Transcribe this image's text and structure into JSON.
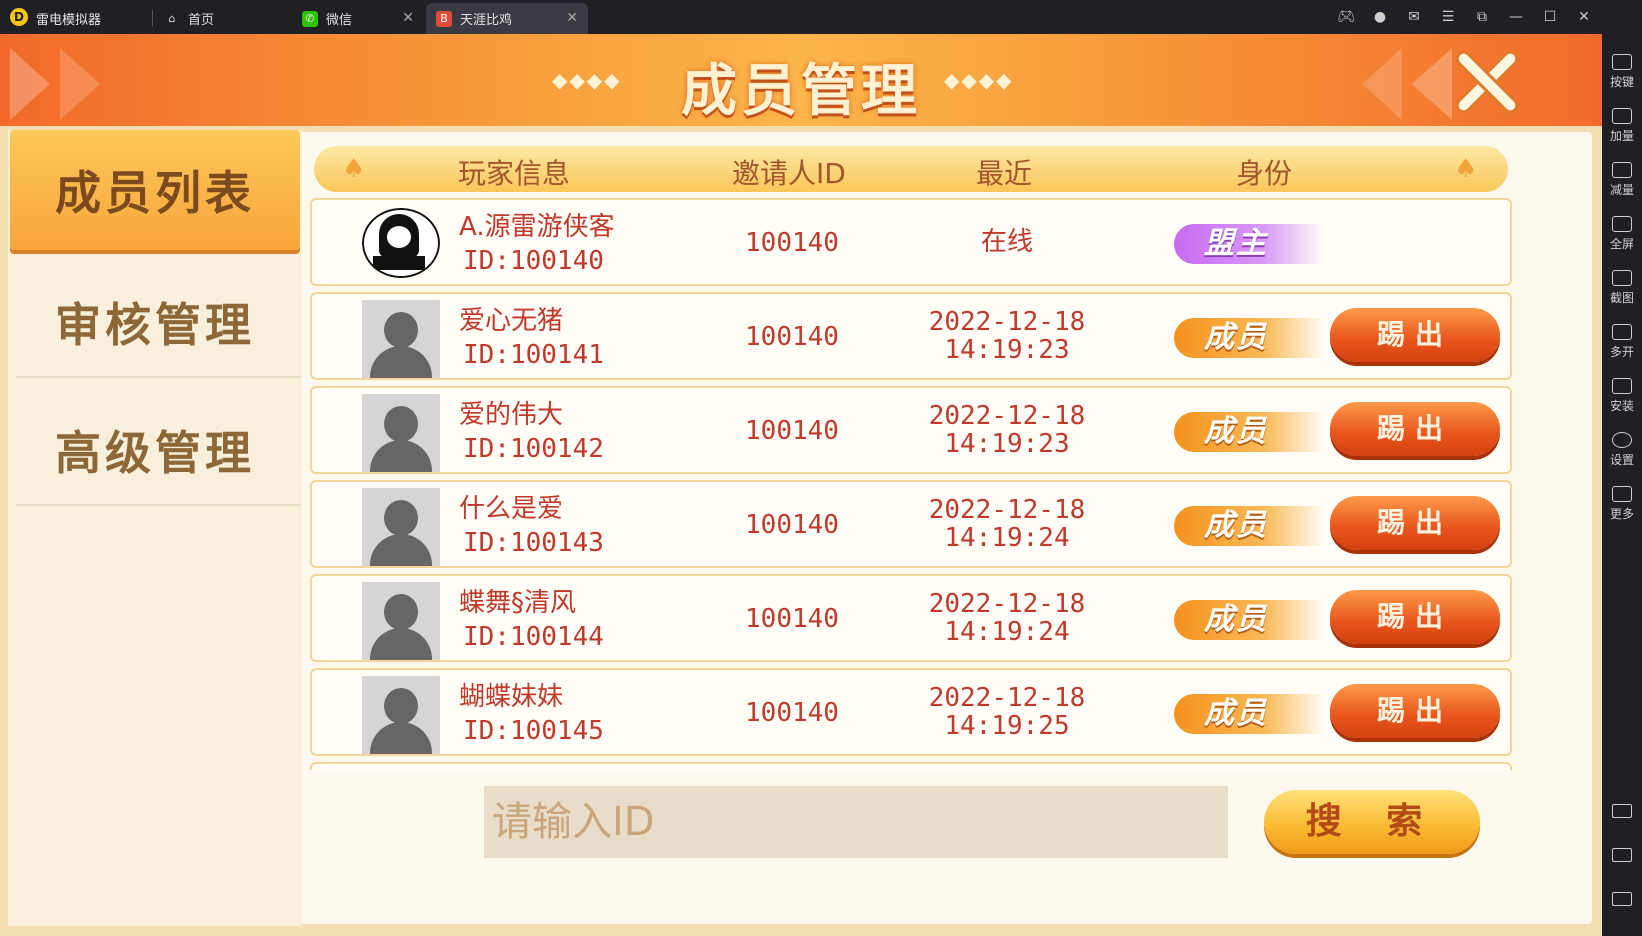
{
  "titlebar": {
    "app_name": "雷电模拟器",
    "tabs": [
      {
        "label": "首页"
      },
      {
        "label": "微信"
      },
      {
        "label": "天涯比鸡"
      }
    ]
  },
  "rightbar": {
    "items": [
      {
        "label": "按键"
      },
      {
        "label": "加量"
      },
      {
        "label": "减量"
      },
      {
        "label": "全屏"
      },
      {
        "label": "截图"
      },
      {
        "label": "多开"
      },
      {
        "label": "安装"
      },
      {
        "label": "设置"
      },
      {
        "label": "更多"
      }
    ]
  },
  "header": {
    "title": "成员管理",
    "deco_left": "◆◆◆◆",
    "deco_right": "◆◆◆◆"
  },
  "sidebar": {
    "items": [
      {
        "label": "成员列表",
        "active": true
      },
      {
        "label": "审核管理",
        "active": false
      },
      {
        "label": "高级管理",
        "active": false
      }
    ]
  },
  "table": {
    "columns": [
      "玩家信息",
      "邀请人ID",
      "最近",
      "身份"
    ],
    "rows": [
      {
        "name": "A.源雷游侠客",
        "id": "ID:100140",
        "inviter": "100140",
        "recent_line1": "在线",
        "recent_line2": "",
        "role": "盟主",
        "kick": ""
      },
      {
        "name": "爱心无猪",
        "id": "ID:100141",
        "inviter": "100140",
        "recent_line1": "2022-12-18",
        "recent_line2": "14:19:23",
        "role": "成员",
        "kick": "踢出"
      },
      {
        "name": "爱的伟大",
        "id": "ID:100142",
        "inviter": "100140",
        "recent_line1": "2022-12-18",
        "recent_line2": "14:19:23",
        "role": "成员",
        "kick": "踢出"
      },
      {
        "name": "什么是爱",
        "id": "ID:100143",
        "inviter": "100140",
        "recent_line1": "2022-12-18",
        "recent_line2": "14:19:24",
        "role": "成员",
        "kick": "踢出"
      },
      {
        "name": "蝶舞§清风",
        "id": "ID:100144",
        "inviter": "100140",
        "recent_line1": "2022-12-18",
        "recent_line2": "14:19:24",
        "role": "成员",
        "kick": "踢出"
      },
      {
        "name": "蝴蝶妹妹",
        "id": "ID:100145",
        "inviter": "100140",
        "recent_line1": "2022-12-18",
        "recent_line2": "14:19:25",
        "role": "成员",
        "kick": "踢出"
      }
    ]
  },
  "search": {
    "placeholder": "请输入ID",
    "button_label": "搜 索"
  }
}
